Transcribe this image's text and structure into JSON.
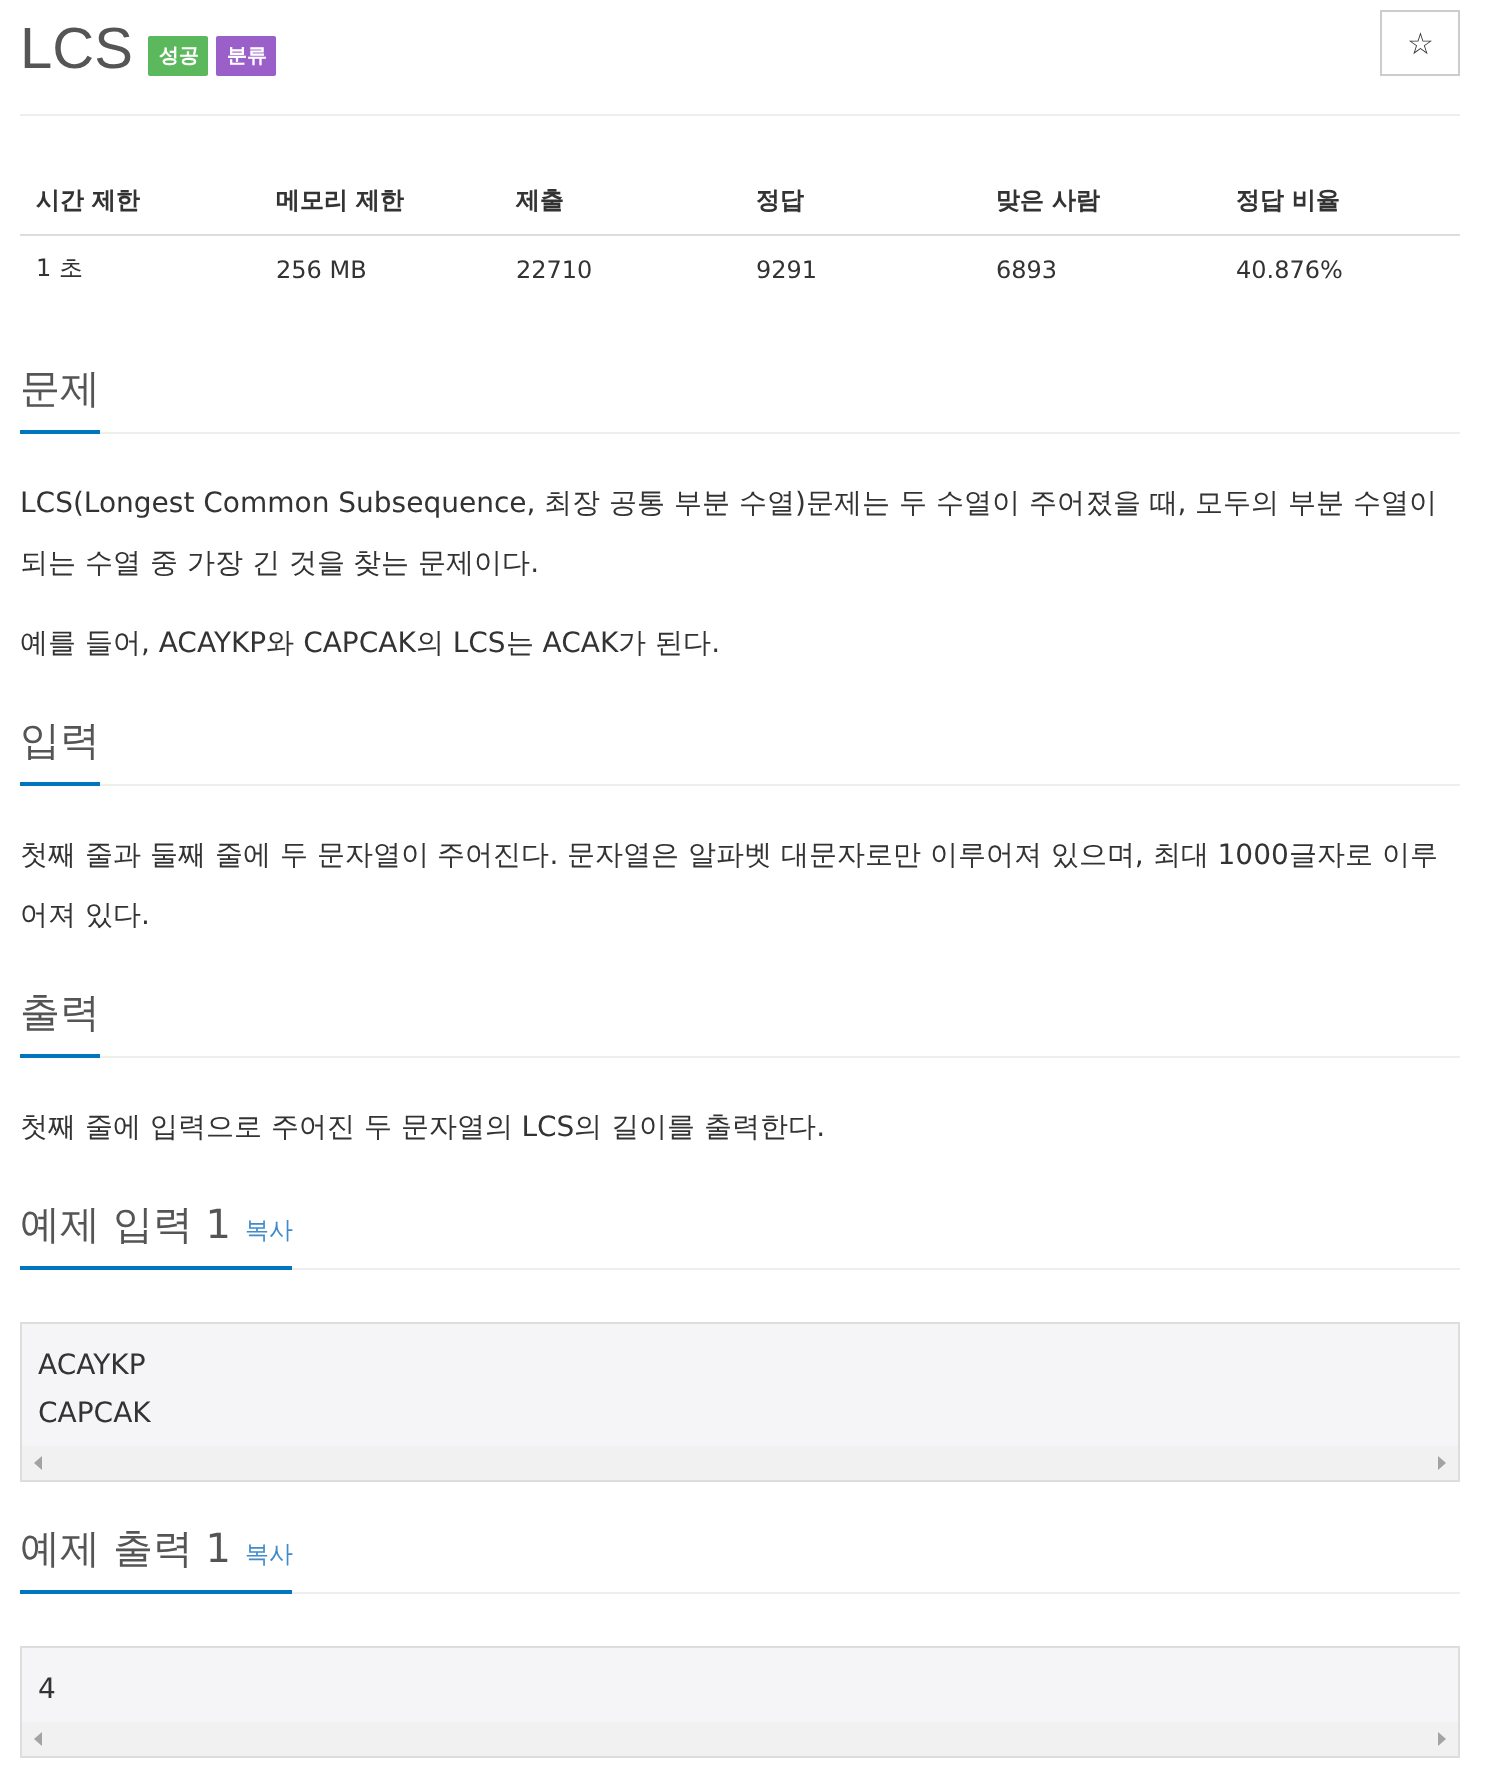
{
  "title": "LCS",
  "tags": [
    {
      "label": "성공",
      "color": "#5cb85c"
    },
    {
      "label": "분류",
      "color": "#9b5fc9"
    }
  ],
  "star_button": {
    "icon": "☆"
  },
  "info_table": {
    "columns": [
      "시간 제한",
      "메모리 제한",
      "제출",
      "정답",
      "맞은 사람",
      "정답 비율"
    ],
    "rows": [
      [
        "1 초",
        "256 MB",
        "22710",
        "9291",
        "6893",
        "40.876%"
      ]
    ]
  },
  "sections": [
    {
      "kind": "text",
      "heading": "문제",
      "paragraphs": [
        "LCS(Longest Common Subsequence, 최장 공통 부분 수열)문제는 두 수열이 주어졌을 때, 모두의 부분 수열이 되는 수열 중 가장 긴 것을 찾는 문제이다.",
        "예를 들어, ACAYKP와 CAPCAK의 LCS는 ACAK가 된다."
      ]
    },
    {
      "kind": "text",
      "heading": "입력",
      "paragraphs": [
        "첫째 줄과 둘째 줄에 두 문자열이 주어진다. 문자열은 알파벳 대문자로만 이루어져 있으며, 최대 1000글자로 이루어져 있다."
      ]
    },
    {
      "kind": "text",
      "heading": "출력",
      "paragraphs": [
        "첫째 줄에 입력으로 주어진 두 문자열의 LCS의 길이를 출력한다."
      ]
    },
    {
      "kind": "sample",
      "heading": "예제 입력 1",
      "copy_label": "복사",
      "lines": [
        "ACAYKP",
        "CAPCAK"
      ]
    },
    {
      "kind": "sample",
      "heading": "예제 출력 1",
      "copy_label": "복사",
      "lines": [
        "4"
      ]
    }
  ]
}
